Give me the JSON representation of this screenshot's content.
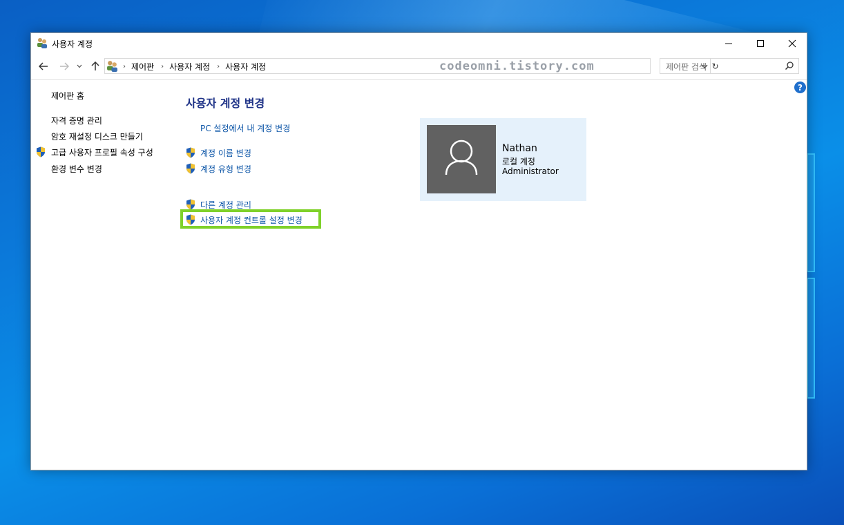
{
  "window": {
    "title": "사용자 계정"
  },
  "address": {
    "breadcrumbs": [
      "제어판",
      "사용자 계정",
      "사용자 계정"
    ],
    "watermark": "codeomni.tistory.com"
  },
  "search": {
    "placeholder": "제어판 검색"
  },
  "sidebar": {
    "home": "제어판 홈",
    "items": [
      {
        "label": "자격 증명 관리",
        "shield": false
      },
      {
        "label": "암호 재설정 디스크 만들기",
        "shield": false
      },
      {
        "label": "고급 사용자 프로필 속성 구성",
        "shield": true
      },
      {
        "label": "환경 변수 변경",
        "shield": false
      }
    ]
  },
  "main": {
    "heading": "사용자 계정 변경",
    "tasks": [
      {
        "label": "PC 설정에서 내 계정 변경",
        "shield": false
      },
      {
        "label": "계정 이름 변경",
        "shield": true
      },
      {
        "label": "계정 유형 변경",
        "shield": true
      }
    ],
    "other_tasks": [
      {
        "label": "다른 계정 관리",
        "shield": true
      },
      {
        "label": "사용자 계정 컨트롤 설정 변경",
        "shield": true,
        "highlighted": true
      }
    ]
  },
  "account": {
    "name": "Nathan",
    "type": "로컬 계정",
    "role": "Administrator"
  },
  "colors": {
    "link": "#0f57a8",
    "heading": "#1e3287",
    "highlight": "#7fd12a",
    "card": "#e5f1fb"
  }
}
